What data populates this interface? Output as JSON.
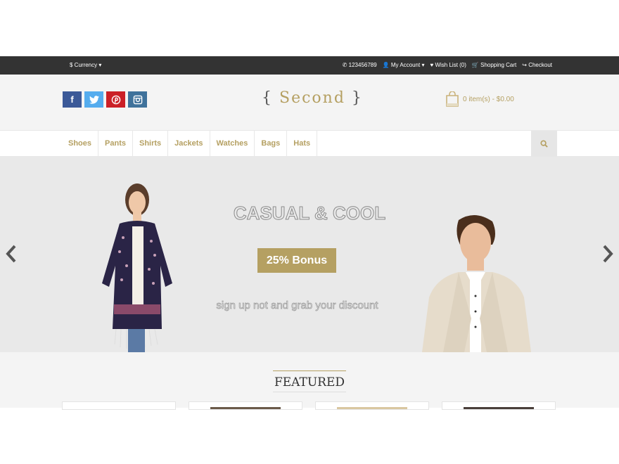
{
  "topbar": {
    "currency": "Currency",
    "phone": "123456789",
    "account": "My Account",
    "wishlist": "Wish List (0)",
    "cart": "Shopping Cart",
    "checkout": "Checkout"
  },
  "header": {
    "logo": "Second",
    "cart_summary": "0 item(s) - $0.00"
  },
  "social": [
    "facebook-icon",
    "twitter-icon",
    "pinterest-icon",
    "instagram-icon"
  ],
  "nav": [
    "Shoes",
    "Pants",
    "Shirts",
    "Jackets",
    "Watches",
    "Bags",
    "Hats"
  ],
  "hero": {
    "title": "CASUAL & COOL",
    "button": "25% Bonus",
    "subtitle": "sign up not and grab your discount"
  },
  "featured": {
    "heading": "FEATURED"
  },
  "colors": {
    "accent": "#b5a062",
    "topbar": "#333333"
  }
}
